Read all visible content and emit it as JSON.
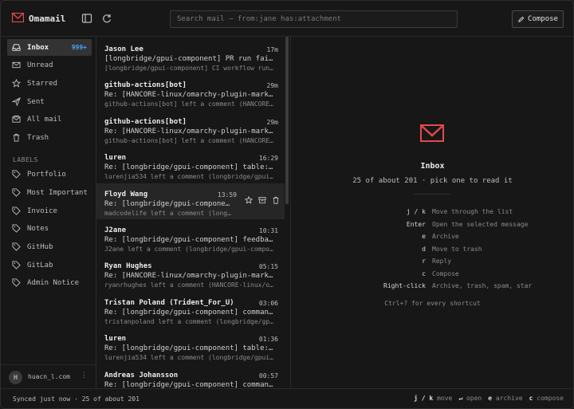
{
  "app": {
    "title": "Omamail"
  },
  "search": {
    "placeholder": "Search mail — from:jane has:attachment"
  },
  "compose": {
    "label": "Compose"
  },
  "sidebar": {
    "items": [
      {
        "label": "Inbox",
        "badge": "999+",
        "icon": "inbox-icon"
      },
      {
        "label": "Unread",
        "icon": "envelope-icon"
      },
      {
        "label": "Starred",
        "icon": "star-icon"
      },
      {
        "label": "Sent",
        "icon": "send-icon"
      },
      {
        "label": "All mail",
        "icon": "mail-stack-icon"
      },
      {
        "label": "Trash",
        "icon": "trash-icon"
      }
    ],
    "labels_heading": "LABELS",
    "labels": [
      {
        "label": "Portfolio"
      },
      {
        "label": "Most Important"
      },
      {
        "label": "Invoice"
      },
      {
        "label": "Notes"
      },
      {
        "label": "GitHub"
      },
      {
        "label": "GitLab"
      },
      {
        "label": "Admin Notice"
      }
    ],
    "account": {
      "initial": "H",
      "name": "huacn_l.com",
      "more": "⋮"
    }
  },
  "messages": [
    {
      "from": "Jason Lee",
      "time": "17m",
      "subject": "[longbridge/gpui-component] PR run failed: CI - ...",
      "preview": "[longbridge/gpui-component] CI workflow run C..."
    },
    {
      "from": "github-actions[bot]",
      "time": "29m",
      "subject": "Re: [HANCORE-linux/omarchy-plugin-marketplace]",
      "preview": "github-actions[bot] left a comment (HANCORE-l..."
    },
    {
      "from": "github-actions[bot]",
      "time": "29m",
      "subject": "Re: [HANCORE-linux/omarchy-plugin-marketplace]",
      "preview": "github-actions[bot] left a comment (HANCORE-l..."
    },
    {
      "from": "luren",
      "time": "16:29",
      "subject": "Re: [longbridge/gpui-component] table: Li...",
      "preview": "lurenjia534 left a comment (longbridge/gpui-c..."
    },
    {
      "from": "Floyd Wang",
      "time": "13:59",
      "subject": "Re: [longbridge/gpui-component]...",
      "preview": "madcodelife left a comment (longbr...",
      "hovered": true
    },
    {
      "from": "J2ane",
      "time": "10:31",
      "subject": "Re: [longbridge/gpui-component] feedback:...",
      "preview": "J2ane left a comment (longbridge/gpui-compone..."
    },
    {
      "from": "Ryan Hughes",
      "time": "05:15",
      "subject": "Re: [HANCORE-linux/omarchy-plugin-marketpl...",
      "preview": "ryanrhughes left a comment (HANCORE-linux/oma..."
    },
    {
      "from": "Tristan Poland (Trident_For_U)",
      "time": "03:06",
      "subject": "Re: [longbridge/gpui-component] command: ...",
      "preview": "tristanpoland left a comment (longbridge/gpui..."
    },
    {
      "from": "luren",
      "time": "01:36",
      "subject": "Re: [longbridge/gpui-component] table: Li...",
      "preview": "lurenjia534 left a comment (longbridge/gpui-c..."
    },
    {
      "from": "Andreas Johansson",
      "time": "00:57",
      "subject": "Re: [longbridge/gpui-component] command: ...",
      "preview": ""
    }
  ],
  "reader": {
    "title": "Inbox",
    "subtitle": "25 of about 201 · pick one to read it",
    "shortcuts": [
      {
        "key": "j / k",
        "desc": "Move through the list"
      },
      {
        "key": "Enter",
        "desc": "Open the selected message"
      },
      {
        "key": "e",
        "desc": "Archive"
      },
      {
        "key": "d",
        "desc": "Move to trash"
      },
      {
        "key": "r",
        "desc": "Reply"
      },
      {
        "key": "c",
        "desc": "Compose"
      },
      {
        "key": "Right-click",
        "desc": "Archive, trash, spam, star"
      }
    ],
    "footnote": "Ctrl+? for every shortcut"
  },
  "footer": {
    "status": "Synced just now  ·  25 of about 201",
    "hints": [
      {
        "key": "j / k",
        "label": "move"
      },
      {
        "key": "↵",
        "label": "open"
      },
      {
        "key": "e",
        "label": "archive"
      },
      {
        "key": "c",
        "label": "compose"
      }
    ]
  },
  "colors": {
    "accent": "#e5484d",
    "badge": "#4aa3ff",
    "background": "#171717"
  }
}
